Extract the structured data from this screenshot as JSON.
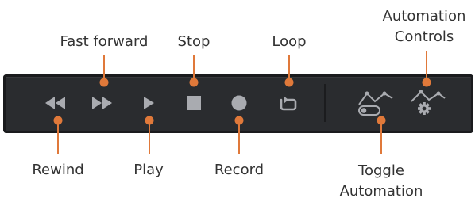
{
  "diagram": {
    "labels": {
      "fast_forward": "Fast forward",
      "stop": "Stop",
      "loop": "Loop",
      "automation_controls_line1": "Automation",
      "automation_controls_line2": "Controls",
      "rewind": "Rewind",
      "play": "Play",
      "record": "Record",
      "toggle_automation_line1": "Toggle",
      "toggle_automation_line2": "Automation"
    },
    "colors": {
      "accent": "#e0793a",
      "bar_background": "#2a2c2f",
      "icon": "#a9abb0",
      "label_text": "#333333"
    },
    "icons": [
      "rewind-icon",
      "fast-forward-icon",
      "play-icon",
      "stop-icon",
      "record-icon",
      "loop-icon",
      "toggle-automation-icon",
      "automation-controls-icon"
    ]
  }
}
